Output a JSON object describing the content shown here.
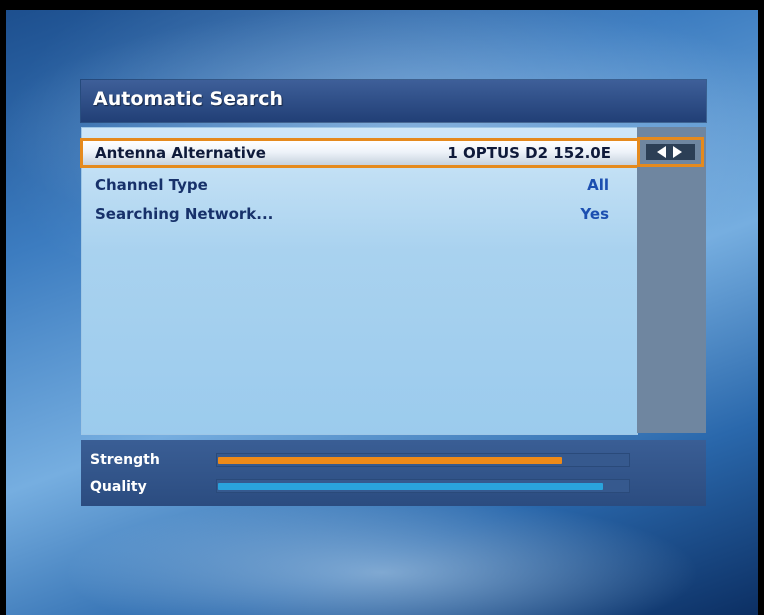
{
  "screen": {
    "title": "Automatic Search"
  },
  "menu": {
    "rows": [
      {
        "label": "Antenna Alternative",
        "value": "1 OPTUS D2 152.0E",
        "selected": true
      },
      {
        "label": "Channel Type",
        "value": "All",
        "selected": false
      },
      {
        "label": "Searching Network...",
        "value": "Yes",
        "selected": false
      }
    ]
  },
  "selector": {
    "icon_left": "arrow-left-icon",
    "icon_right": "arrow-right-icon"
  },
  "signal": {
    "strength_label": "Strength",
    "quality_label": "Quality",
    "strength_fraction": 0.84,
    "quality_fraction": 0.94,
    "strength_color": "#ee8a18",
    "quality_color": "#2aa3dc"
  },
  "colors": {
    "highlight": "#e58a1d",
    "value_text": "#1c4fb0"
  }
}
